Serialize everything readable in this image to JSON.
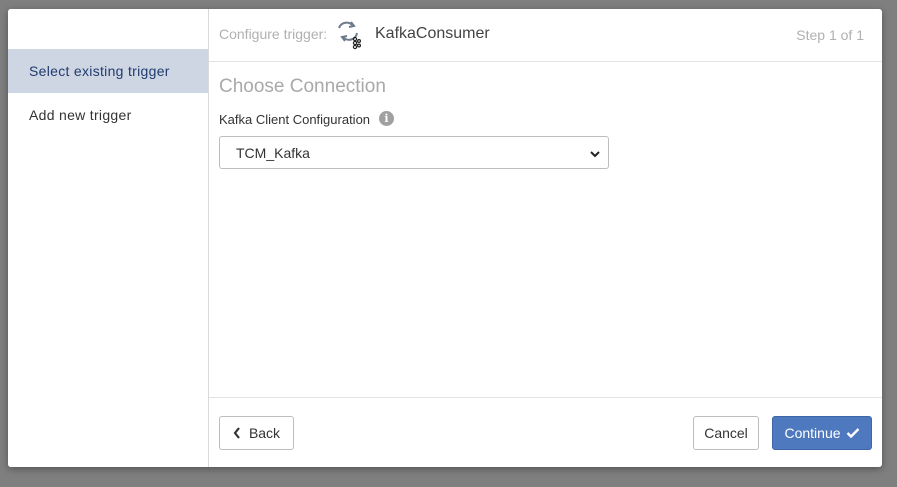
{
  "sidebar": {
    "items": [
      {
        "label": "Select existing trigger",
        "active": true
      },
      {
        "label": "Add new trigger",
        "active": false
      }
    ]
  },
  "header": {
    "label": "Configure trigger:",
    "trigger_icon": "kafka-trigger-icon",
    "trigger_name": "KafkaConsumer",
    "step": "Step 1 of 1"
  },
  "content": {
    "section_title": "Choose Connection",
    "field_label": "Kafka Client Configuration",
    "info_icon": "info-icon",
    "info_glyph": "i",
    "select_value": "TCM_Kafka"
  },
  "footer": {
    "back_label": "Back",
    "cancel_label": "Cancel",
    "continue_label": "Continue"
  },
  "colors": {
    "accent": "#4e79bf",
    "sidebar_active_bg": "#cfd6e3",
    "sidebar_active_text": "#1f3b6e",
    "overlay": "#7f7f7f"
  }
}
